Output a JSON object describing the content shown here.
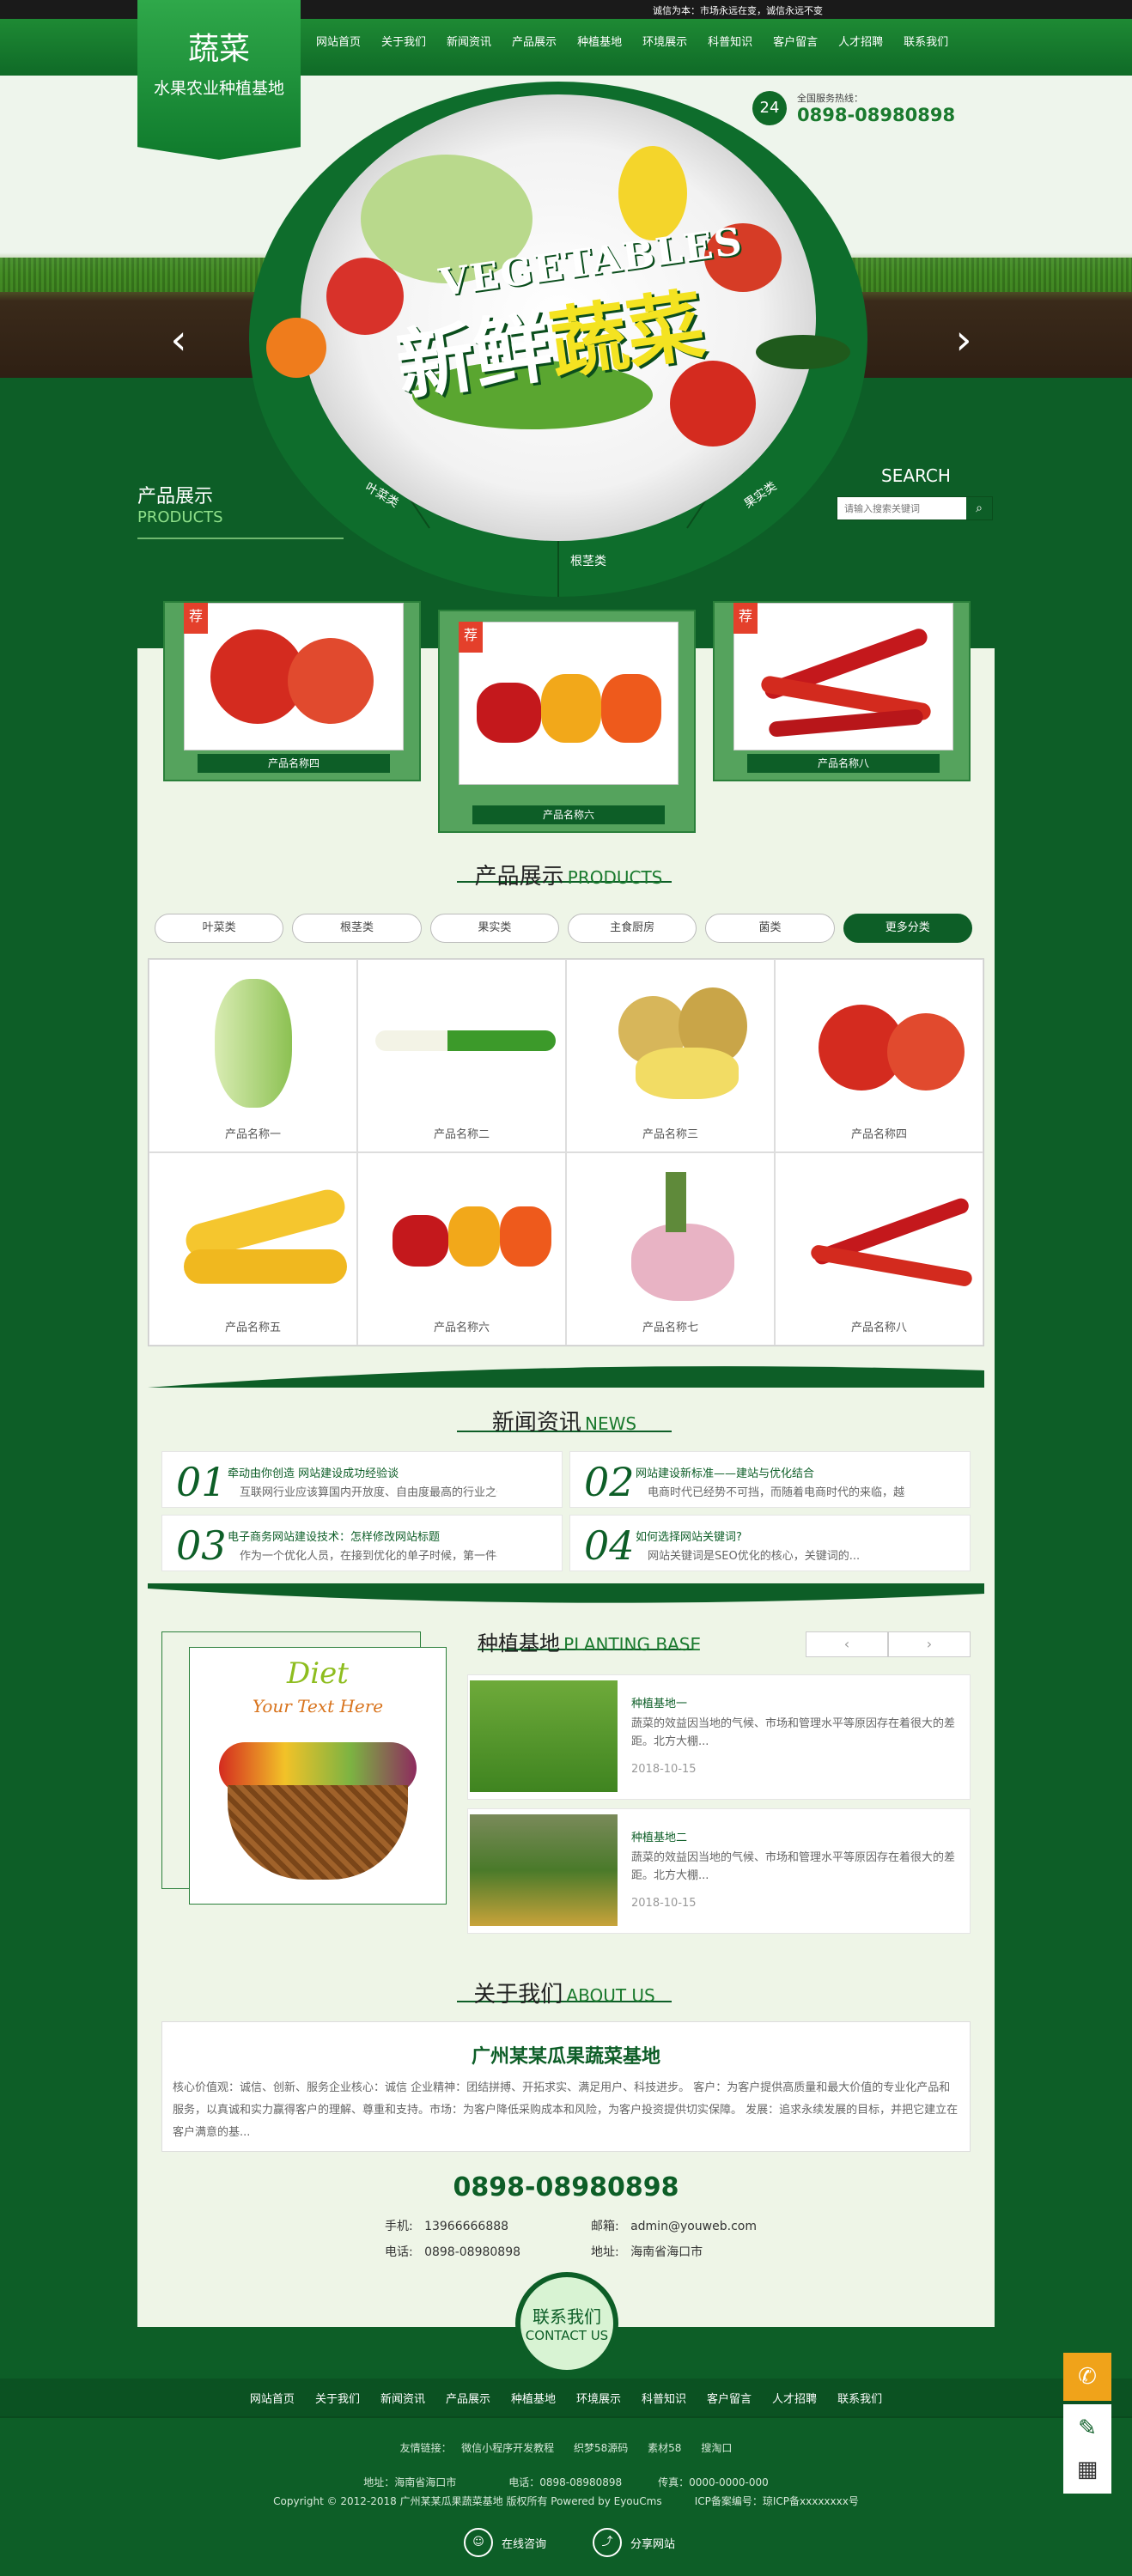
{
  "topbar": {
    "slogan": "诚信为本：市场永远在变，诚信永远不变"
  },
  "logo": {
    "title": "蔬菜",
    "subtitle": "水果农业种植基地"
  },
  "nav": [
    "网站首页",
    "关于我们",
    "新闻资讯",
    "产品展示",
    "种植基地",
    "环境展示",
    "科普知识",
    "客户留言",
    "人才招聘",
    "联系我们"
  ],
  "hotline": {
    "label": "全国服务热线：",
    "number": "0898-08980898",
    "badge": "24"
  },
  "hero": {
    "en": "VEGETABLES",
    "cn_white": "新鲜",
    "cn_yellow": "蔬菜",
    "cat_left": "叶菜类",
    "cat_bottom": "根茎类",
    "cat_right": "果实类",
    "prev": "‹",
    "next": "›"
  },
  "products_side": {
    "cn": "产品展示",
    "en": "PRODUCTS"
  },
  "search": {
    "label": "SEARCH",
    "placeholder": "请输入搜索关键词",
    "icon": "search-icon"
  },
  "featured": [
    {
      "name": "产品名称四",
      "tag": "荐"
    },
    {
      "name": "产品名称六",
      "tag": "荐"
    },
    {
      "name": "产品名称八",
      "tag": "荐"
    }
  ],
  "products": {
    "cn": "产品展示",
    "en": "PRODUCTS",
    "tabs": [
      "叶菜类",
      "根茎类",
      "果实类",
      "主食厨房",
      "菌类",
      "更多分类"
    ],
    "items": [
      "产品名称一",
      "产品名称二",
      "产品名称三",
      "产品名称四",
      "产品名称五",
      "产品名称六",
      "产品名称七",
      "产品名称八"
    ]
  },
  "news": {
    "cn": "新闻资讯",
    "en": "NEWS",
    "items": [
      {
        "no": "01",
        "title": "牵动由你创造 网站建设成功经验谈",
        "desc": "互联网行业应该算国内开放度、自由度最高的行业之一。..."
      },
      {
        "no": "02",
        "title": "网站建设新标准——建站与优化结合",
        "desc": "电商时代已经势不可挡，而随着电商时代的来临，越来越..."
      },
      {
        "no": "03",
        "title": "电子商务网站建设技术：怎样修改网站标题",
        "desc": "作为一个优化人员，在接到优化的单子时候，第一件要做..."
      },
      {
        "no": "04",
        "title": "如何选择网站关键词?",
        "desc": "网站关键词是SEO优化的核心，关键词的..."
      }
    ]
  },
  "diet": {
    "title": "Diet",
    "sub": "Your Text Here"
  },
  "base": {
    "cn": "种植基地",
    "en": "PLANTING BASE",
    "prev": "‹",
    "next": "›",
    "items": [
      {
        "title": "种植基地一",
        "desc": "蔬菜的效益因当地的气候、市场和管理水平等原因存在着很大的差距。北方大棚...",
        "date": "2018-10-15"
      },
      {
        "title": "种植基地二",
        "desc": "蔬菜的效益因当地的气候、市场和管理水平等原因存在着很大的差距。北方大棚...",
        "date": "2018-10-15"
      }
    ]
  },
  "about": {
    "cn": "关于我们",
    "en": "ABOUT US",
    "company": "广州某某瓜果蔬菜基地",
    "text": "核心价值观：诚信、创新、服务企业核心：诚信 企业精神：团结拼搏、开拓求实、满足用户、科技进步。 客户：为客户提供高质量和最大价值的专业化产品和服务，以真诚和实力赢得客户的理解、尊重和支持。市场：为客户降低采购成本和风险，为客户投资提供切实保障。 发展：追求永续发展的目标，并把它建立在客户满意的基..."
  },
  "contact": {
    "tel": "0898-08980898",
    "mobile_lbl": "手机:",
    "mobile": "13966666888",
    "email_lbl": "邮箱:",
    "email": "admin@youweb.com",
    "phone_lbl": "电话:",
    "phone": "0898-08980898",
    "addr_lbl": "地址:",
    "addr": "海南省海口市",
    "btn_cn": "联系我们",
    "btn_en": "CONTACT US"
  },
  "footer": {
    "nav": [
      "网站首页",
      "关于我们",
      "新闻资讯",
      "产品展示",
      "种植基地",
      "环境展示",
      "科普知识",
      "客户留言",
      "人才招聘",
      "联系我们"
    ],
    "links": "友情链接：   微信小程序开发教程      织梦58源码      素材58      搜淘口",
    "info": "地址：海南省海口市                电话：0898-08980898           传真：0000-0000-000",
    "copy": "Copyright © 2012-2018 广州某某瓜果蔬菜基地 版权所有 Powered by EyouCms          ICP备案编号：琼ICP备xxxxxxxx号",
    "consult": "在线咨询",
    "share": "分享网站"
  },
  "colors": {
    "brand": "#0d5e27",
    "accent": "#f4e321",
    "tag": "#e4402b"
  }
}
